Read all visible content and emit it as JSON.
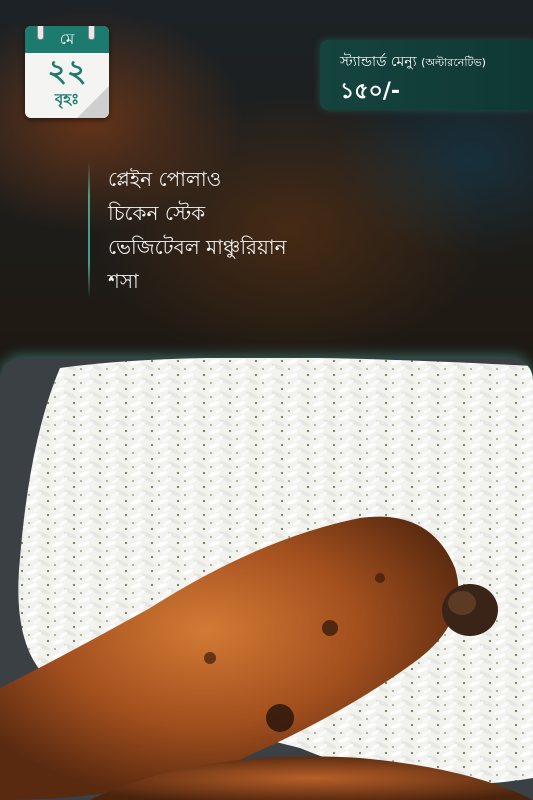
{
  "calendar": {
    "month": "মে",
    "day": "২২",
    "weekday": "বৃহঃ"
  },
  "price_badge": {
    "title": "স্ট্যান্ডার্ড মেন্যু",
    "subtitle": "(অল্টারনেটিভ)",
    "price": "১৫০/-"
  },
  "menu": {
    "items": [
      "প্লেইন পোলাও",
      "চিকেন স্টেক",
      "ভেজিটেবল মাঞ্চুরিয়ান",
      "শসা"
    ]
  },
  "photo": {
    "icon": "rice-and-chicken-image"
  },
  "colors": {
    "accent": "#1d7a6e",
    "badge_bg": "#15443f",
    "glow": "#5ad2c8"
  }
}
